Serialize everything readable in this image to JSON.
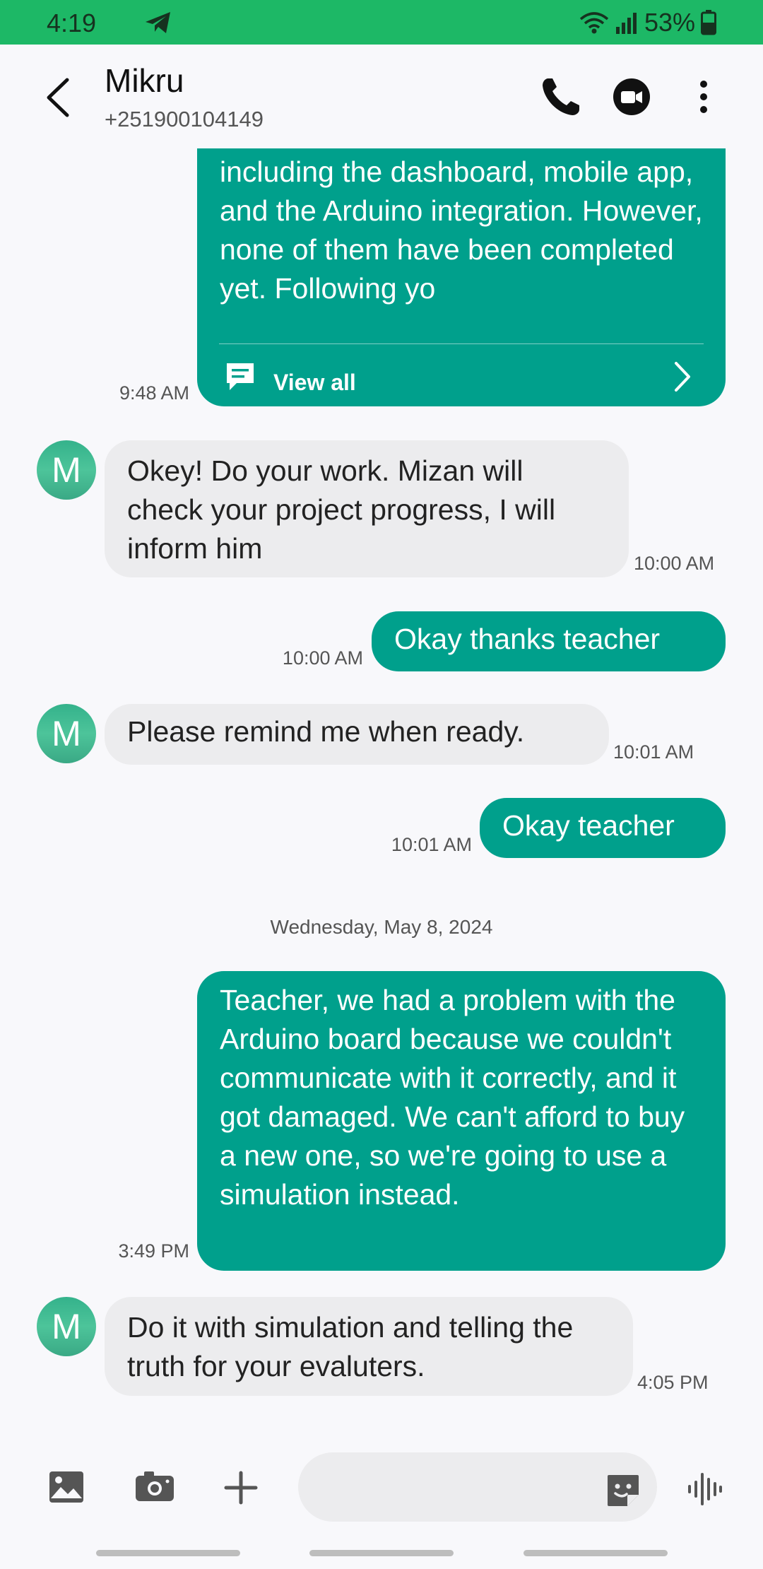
{
  "status_bar": {
    "time": "4:19",
    "battery": "53%",
    "color": "#1db866"
  },
  "header": {
    "contact_name": "Mikru",
    "contact_phone": "+251900104149"
  },
  "messages": [
    {
      "direction": "outgoing",
      "text": "including the dashboard, mobile app, and the Arduino integration. However, none of them have been completed yet. Following yo",
      "time": "9:48 AM",
      "truncated": true,
      "view_all_label": "View all"
    },
    {
      "direction": "incoming",
      "avatar": "M",
      "text": "Okey! Do your work. Mizan will check your project progress, I will inform him",
      "time": "10:00 AM"
    },
    {
      "direction": "outgoing",
      "text": "Okay thanks teacher",
      "time": "10:00 AM"
    },
    {
      "direction": "incoming",
      "avatar": "M",
      "text": "Please remind me when ready.",
      "time": "10:01 AM"
    },
    {
      "direction": "outgoing",
      "text": "Okay teacher",
      "time": "10:01 AM"
    },
    {
      "type": "date_separator",
      "text": "Wednesday, May 8, 2024"
    },
    {
      "direction": "outgoing",
      "text": "Teacher, we had a problem with the Arduino board because we couldn't communicate with it correctly, and it got damaged. We can't afford to buy a new one, so we're going to use a simulation instead.",
      "time": "3:49 PM"
    },
    {
      "direction": "incoming",
      "avatar": "M",
      "text": "Do it with simulation and telling the truth for your evaluters.",
      "time": "4:05 PM"
    }
  ],
  "composer": {
    "placeholder": "",
    "icons": [
      "gallery-icon",
      "camera-icon",
      "plus-icon",
      "sticker-icon",
      "voice-icon"
    ]
  },
  "colors": {
    "outgoing_bubble": "#00a08c",
    "incoming_bubble": "#ececee",
    "avatar": "#3db58e"
  }
}
